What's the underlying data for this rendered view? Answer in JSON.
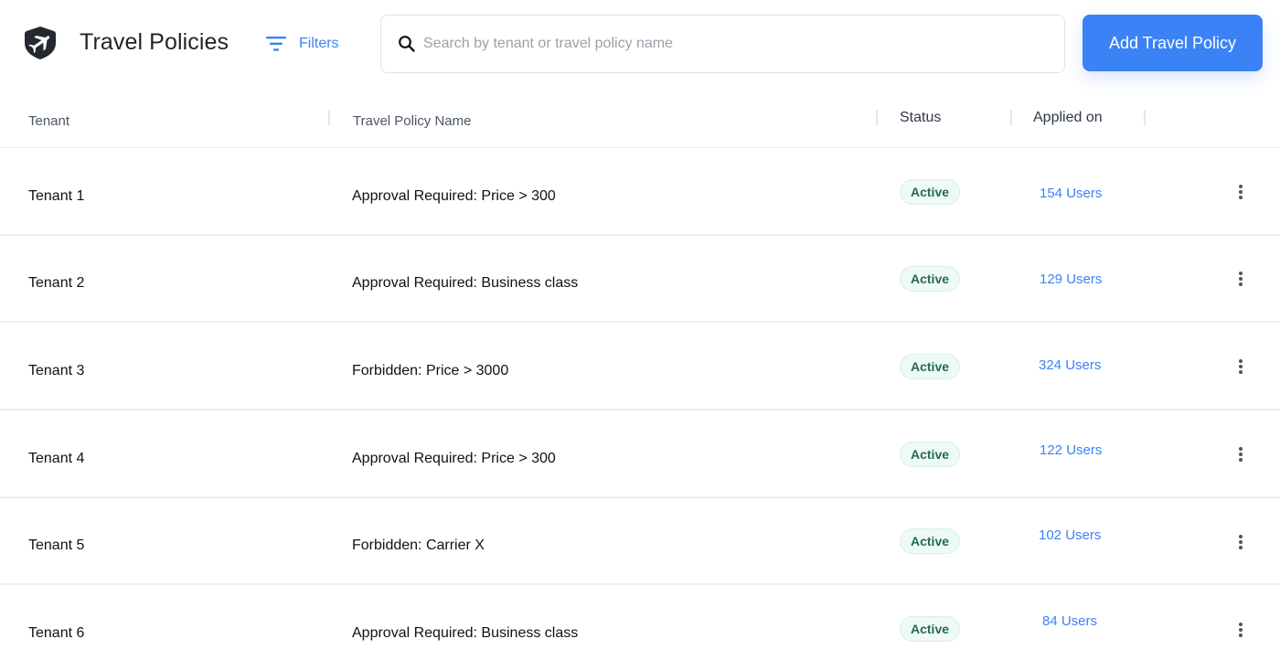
{
  "header": {
    "title": "Travel Policies",
    "logo_icon": "shield-plane-icon",
    "filters_label": "Filters",
    "filters_icon": "filter-lines-icon",
    "search_placeholder": "Search by tenant or travel policy name",
    "search_value": "",
    "search_icon": "search-icon",
    "add_button_label": "Add Travel Policy"
  },
  "table": {
    "columns": [
      "Tenant",
      "Travel Policy Name",
      "Status",
      "Applied on"
    ],
    "rows": [
      {
        "tenant": "Tenant 1",
        "policy": "Approval Required: Price > 300",
        "status": "Active",
        "applied": "154 Users"
      },
      {
        "tenant": "Tenant 2",
        "policy": "Approval Required: Business class",
        "status": "Active",
        "applied": "129 Users"
      },
      {
        "tenant": "Tenant 3",
        "policy": "Forbidden: Price > 3000",
        "status": "Active",
        "applied": "324 Users"
      },
      {
        "tenant": "Tenant 4",
        "policy": "Approval Required: Price > 300",
        "status": "Active",
        "applied": "122 Users"
      },
      {
        "tenant": "Tenant 5",
        "policy": "Forbidden: Carrier X",
        "status": "Active",
        "applied": "102 Users"
      },
      {
        "tenant": "Tenant 6",
        "policy": "Approval Required: Business class",
        "status": "Active",
        "applied": "84 Users"
      }
    ]
  },
  "colors": {
    "accent": "#3b82f6",
    "status_active_text": "#256b50",
    "status_active_bg": "#eefaf4",
    "title": "#1f2328",
    "logo": "#24292f"
  }
}
